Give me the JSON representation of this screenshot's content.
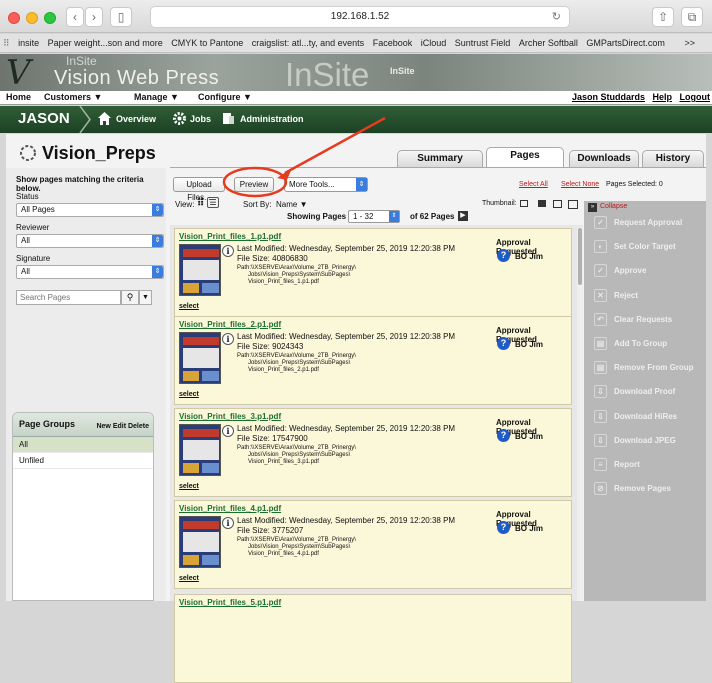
{
  "browser": {
    "url": "192.168.1.52",
    "bookmarks": [
      "insite",
      "Paper weight...son and more",
      "CMYK to Pantone",
      "craigslist: atl...ty, and events",
      "Facebook",
      "iCloud",
      "Suntrust Field",
      "Archer Softball",
      "GMPartsDirect.com"
    ],
    "overflow": ">>"
  },
  "banner": {
    "small": "InSite",
    "big": "Vision Web Press",
    "center": "InSite",
    "center_small": "InSite"
  },
  "menubar": {
    "items": [
      "Home",
      "Customers ▼",
      "Manage ▼",
      "Configure ▼"
    ],
    "user_link": "Jason Studdards",
    "help": "Help",
    "logout": "Logout"
  },
  "nav": {
    "user": "JASON",
    "overview": "Overview",
    "jobs": "Jobs",
    "administration": "Administration"
  },
  "page": {
    "title": "Vision_Preps"
  },
  "tabs": [
    "Summary",
    "Pages",
    "Downloads",
    "History"
  ],
  "filters": {
    "heading": "Show pages matching the criteria below.",
    "status_label": "Status",
    "status_value": "All Pages",
    "reviewer_label": "Reviewer",
    "reviewer_value": "All",
    "signature_label": "Signature",
    "signature_value": "All",
    "search_placeholder": "Search Pages"
  },
  "page_groups": {
    "title": "Page Groups",
    "actions": "New Edit Delete",
    "items": [
      "All",
      "Unfiled"
    ]
  },
  "toolbar": {
    "upload": "Upload Files...",
    "preview": "Preview",
    "more_tools": "More Tools...",
    "select_all": "Select All",
    "select_none": "Select None",
    "pages_selected": "Pages Selected:  0",
    "view_label": "View:",
    "sort_label": "Sort By:",
    "sort_value": "Name ▼",
    "thumbnail_label": "Thumbnail:",
    "collapse": "Collapse",
    "showing_label": "Showing Pages",
    "range": "1 - 32",
    "of_label": "of 62 Pages"
  },
  "pages": [
    {
      "name": "Vision_Print_files_1.p1.pdf",
      "modified": "Last Modified: Wednesday, September 25, 2019 12:20:38 PM",
      "size": "File Size: 40806830",
      "path1": "Path:\\\\XSERVE\\Arax\\Volume_2TB_Prinergy\\",
      "path2": "Jobs\\Vision_Preps\\System\\SubPages\\",
      "path3": "Vision_Print_files_1.p1.pdf",
      "select": "select",
      "status": "Approval Requested",
      "assignee": "BO Jim"
    },
    {
      "name": "Vision_Print_files_2.p1.pdf",
      "modified": "Last Modified: Wednesday, September 25, 2019 12:20:38 PM",
      "size": "File Size: 9024343",
      "path1": "Path:\\\\XSERVE\\Arax\\Volume_2TB_Prinergy\\",
      "path2": "Jobs\\Vision_Preps\\System\\SubPages\\",
      "path3": "Vision_Print_files_2.p1.pdf",
      "select": "select",
      "status": "Approval Requested",
      "assignee": "BO Jim"
    },
    {
      "name": "Vision_Print_files_3.p1.pdf",
      "modified": "Last Modified: Wednesday, September 25, 2019 12:20:38 PM",
      "size": "File Size: 17547900",
      "path1": "Path:\\\\XSERVE\\Arax\\Volume_2TB_Prinergy\\",
      "path2": "Jobs\\Vision_Preps\\System\\SubPages\\",
      "path3": "Vision_Print_files_3.p1.pdf",
      "select": "select",
      "status": "Approval Requested",
      "assignee": "BO Jim"
    },
    {
      "name": "Vision_Print_files_4.p1.pdf",
      "modified": "Last Modified: Wednesday, September 25, 2019 12:20:38 PM",
      "size": "File Size: 3775207",
      "path1": "Path:\\\\XSERVE\\Arax\\Volume_2TB_Prinergy\\",
      "path2": "Jobs\\Vision_Preps\\System\\SubPages\\",
      "path3": "Vision_Print_files_4.p1.pdf",
      "select": "select",
      "status": "Approval Requested",
      "assignee": "BO Jim"
    },
    {
      "name": "Vision_Print_files_5.p1.pdf"
    }
  ],
  "actions": [
    "Request Approval",
    "Set Color Target",
    "Approve",
    "Reject",
    "Clear Requests",
    "Add To Group",
    "Remove From Group",
    "Download Proof",
    "Download HiRes",
    "Download JPEG",
    "Report",
    "Remove Pages"
  ],
  "colors": {
    "nav_green": "#1d4124",
    "link_green": "#1a6f2e",
    "card_bg": "#fbf7d9",
    "annotation_red": "#e53b1e",
    "actions_bg": "#b8b8b8"
  }
}
